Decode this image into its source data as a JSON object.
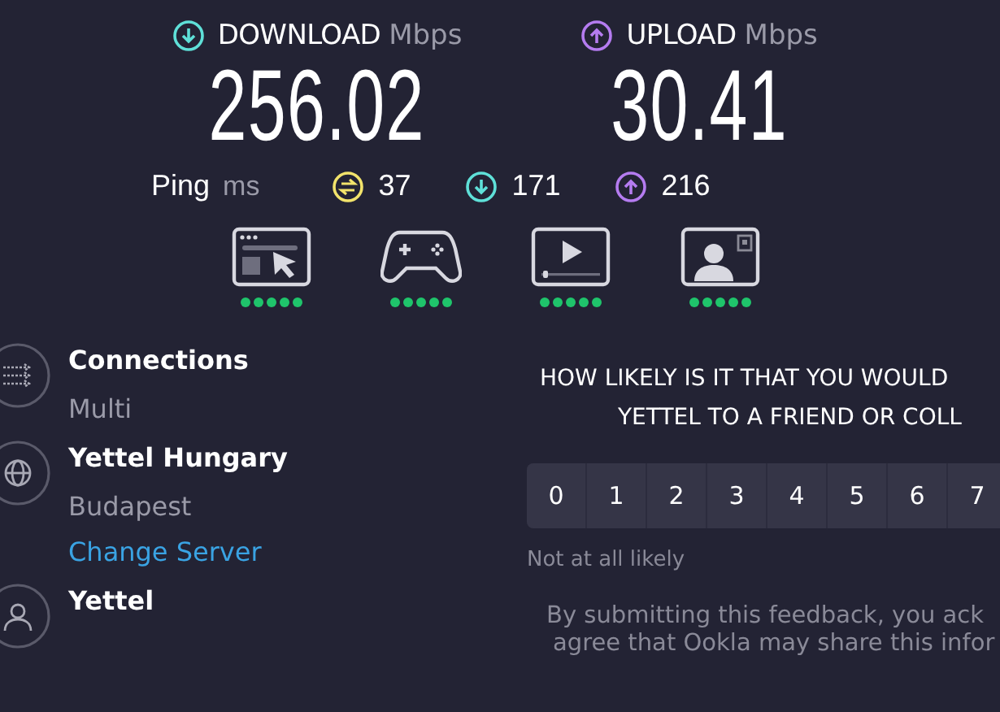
{
  "speeds": [
    {
      "kind": "download",
      "label": "DOWNLOAD",
      "unit": "Mbps",
      "value": "256.02"
    },
    {
      "kind": "upload",
      "label": "UPLOAD",
      "unit": "Mbps",
      "value": "30.41"
    }
  ],
  "ping": {
    "label": "Ping",
    "unit": "ms",
    "readings": [
      {
        "kind": "idle",
        "value": "37"
      },
      {
        "kind": "download",
        "value": "171"
      },
      {
        "kind": "upload",
        "value": "216"
      }
    ]
  },
  "performance": [
    {
      "kind": "browsing",
      "stars": 5
    },
    {
      "kind": "gaming",
      "stars": 5
    },
    {
      "kind": "video",
      "stars": 5
    },
    {
      "kind": "calls",
      "stars": 5
    }
  ],
  "details": [
    {
      "kind": "connections",
      "title": "Connections",
      "subtitle": "Multi"
    },
    {
      "kind": "server",
      "title": "Yettel Hungary",
      "subtitle": "Budapest",
      "link": "Change Server"
    },
    {
      "kind": "provider",
      "title": "Yettel"
    }
  ],
  "survey": {
    "question": [
      "HOW LIKELY IS IT THAT YOU WOULD",
      "YETTEL TO A FRIEND OR COLL"
    ],
    "scale": [
      "0",
      "1",
      "2",
      "3",
      "4",
      "5",
      "6",
      "7"
    ],
    "low_label": "Not at all likely",
    "note": [
      "By submitting this feedback, you ack",
      "agree that Ookla may share this infor"
    ]
  }
}
